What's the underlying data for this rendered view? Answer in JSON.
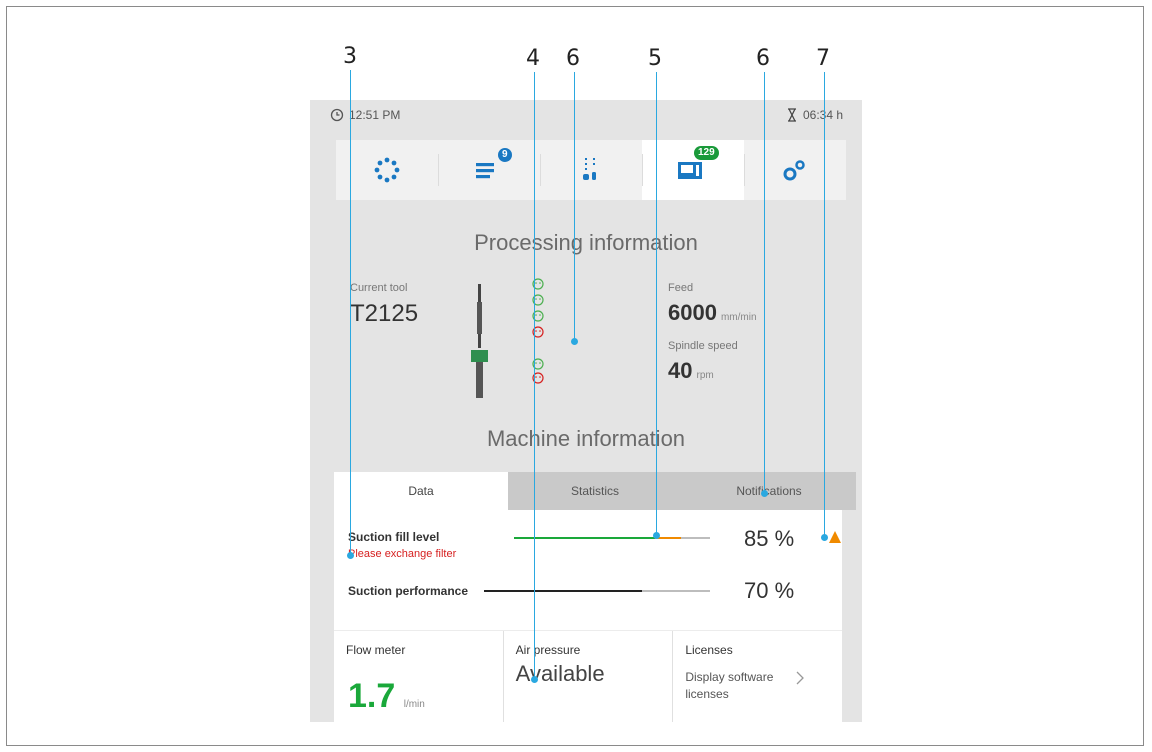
{
  "callouts": [
    "3",
    "4",
    "6",
    "5",
    "6",
    "7"
  ],
  "status": {
    "time": "12:51 PM",
    "remaining": "06:34 h"
  },
  "nav": {
    "items": [
      {
        "icon": "dots-circle-icon"
      },
      {
        "icon": "job-list-icon",
        "badge": "9"
      },
      {
        "icon": "tool-bars-icon"
      },
      {
        "icon": "machine-screen-icon",
        "badge": "129"
      },
      {
        "icon": "gears-icon"
      }
    ]
  },
  "processing": {
    "heading": "Processing information",
    "current_tool_label": "Current tool",
    "current_tool": "T2125",
    "feed_label": "Feed",
    "feed_value": "6000",
    "feed_unit": "mm/min",
    "spindle_label": "Spindle speed",
    "spindle_value": "40",
    "spindle_unit": "rpm"
  },
  "machine": {
    "heading": "Machine information",
    "tabs": [
      "Data",
      "Statistics",
      "Notifications"
    ],
    "active_tab": 0,
    "suction_fill": {
      "label": "Suction fill level",
      "warning": "Please exchange filter",
      "value": "85 %",
      "level": 0.85
    },
    "suction_perf": {
      "label": "Suction performance",
      "value": "70 %",
      "level": 0.7
    },
    "tiles": {
      "flow_meter": {
        "title": "Flow meter",
        "value": "1.7",
        "unit": "l/min"
      },
      "air_pressure": {
        "title": "Air pressure",
        "value": "Available"
      },
      "licenses": {
        "title": "Licenses",
        "link": "Display software licenses"
      }
    }
  },
  "colors": {
    "accent_green": "#1aa83a",
    "warning_red": "#d62020",
    "warning_orange": "#f08a00",
    "callout_blue": "#2aa8e0"
  }
}
